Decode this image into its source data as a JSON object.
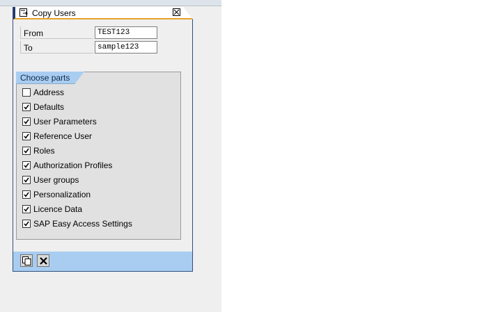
{
  "dialog": {
    "title": "Copy Users",
    "close_icon": "close-x-icon",
    "title_icon": "copy-window-icon"
  },
  "fields": {
    "from": {
      "label": "From",
      "value": "TEST123"
    },
    "to": {
      "label": "To",
      "value": "sample123"
    }
  },
  "group": {
    "title": "Choose parts",
    "items": [
      {
        "label": "Address",
        "checked": false
      },
      {
        "label": "Defaults",
        "checked": true
      },
      {
        "label": "User Parameters",
        "checked": true
      },
      {
        "label": "Reference User",
        "checked": true
      },
      {
        "label": "Roles",
        "checked": true
      },
      {
        "label": "Authorization Profiles",
        "checked": true
      },
      {
        "label": "User groups",
        "checked": true
      },
      {
        "label": "Personalization",
        "checked": true
      },
      {
        "label": "Licence Data",
        "checked": true
      },
      {
        "label": "SAP Easy Access Settings",
        "checked": true
      }
    ]
  },
  "footer": {
    "buttons": [
      {
        "icon": "copy-icon"
      },
      {
        "icon": "cancel-icon"
      }
    ]
  },
  "colors": {
    "accent_blue": "#a9cdf1",
    "title_underline": "#e7a02a",
    "frame_dark": "#2f4f7e"
  }
}
